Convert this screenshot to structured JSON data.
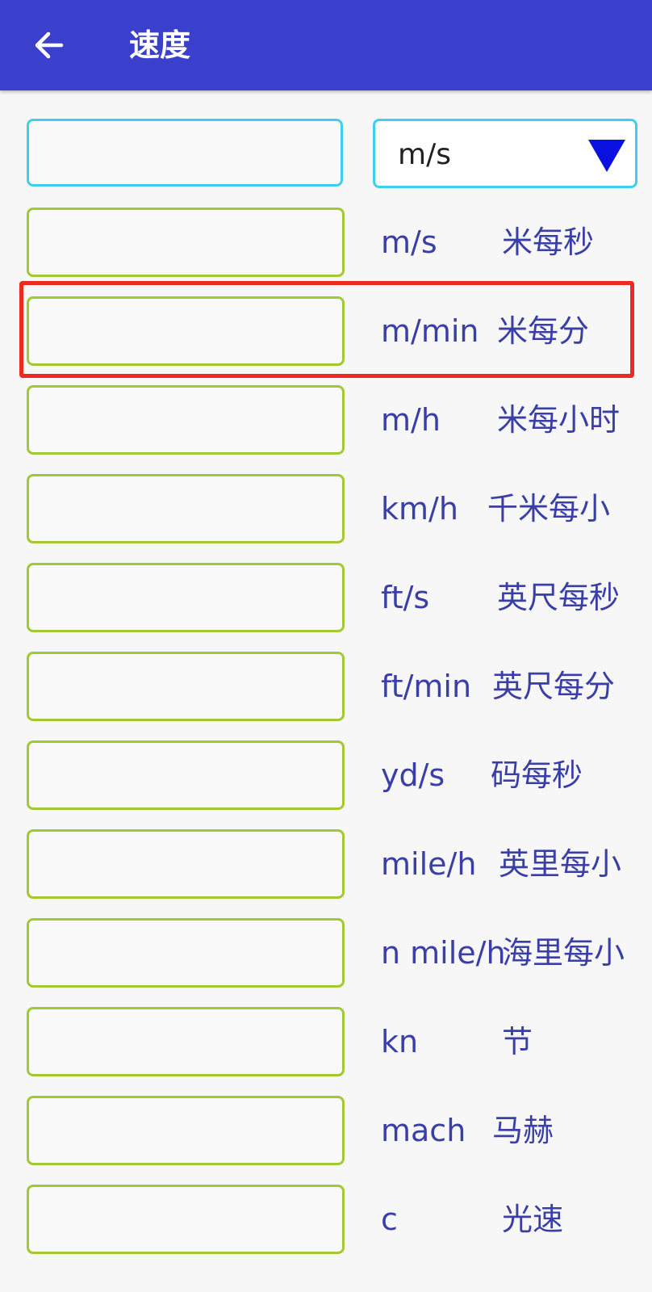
{
  "appbar": {
    "title": "速度",
    "back_icon": "arrow-left-icon",
    "bg": "#3a3fcc"
  },
  "converter": {
    "input_value": "",
    "selected_unit": "m/s",
    "dropdown_icon": "triangle-down-icon"
  },
  "rows": [
    {
      "unit": "m/s",
      "name": "米每秒",
      "value": ""
    },
    {
      "unit": "m/min",
      "name": "米每分",
      "value": ""
    },
    {
      "unit": "m/h",
      "name": "米每小时",
      "value": ""
    },
    {
      "unit": "km/h",
      "name": "千米每小",
      "value": ""
    },
    {
      "unit": "ft/s",
      "name": "英尺每秒",
      "value": ""
    },
    {
      "unit": "ft/min",
      "name": "英尺每分",
      "value": ""
    },
    {
      "unit": "yd/s",
      "name": "码每秒",
      "value": ""
    },
    {
      "unit": "mile/h",
      "name": "英里每小",
      "value": ""
    },
    {
      "unit": "n mile/h",
      "name": "海里每小",
      "value": ""
    },
    {
      "unit": "kn",
      "name": "节",
      "value": ""
    },
    {
      "unit": "mach",
      "name": "马赫",
      "value": ""
    },
    {
      "unit": "c",
      "name": "光速",
      "value": ""
    }
  ],
  "colors": {
    "unit_text": "#3a3fa6",
    "field_border": "#a1c932",
    "main_border": "#3cd1ea",
    "highlight": "#ee2a20"
  }
}
